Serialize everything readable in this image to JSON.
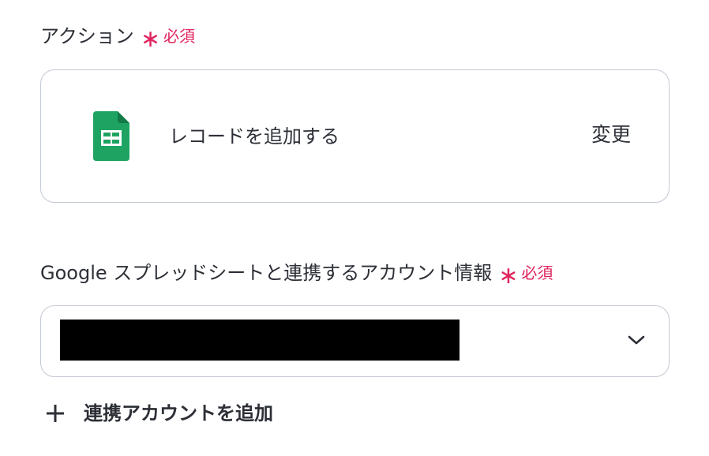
{
  "action_field": {
    "label": "アクション",
    "required_mark": "∗",
    "required_text": "必須",
    "action_name": "レコードを追加する",
    "change_label": "変更",
    "app_icon": "google-sheets-icon"
  },
  "account_field": {
    "label": "Google スプレッドシートと連携するアカウント情報",
    "required_mark": "∗",
    "required_text": "必須",
    "chevron_icon": "chevron-down-icon"
  },
  "add_account": {
    "icon": "plus-icon",
    "label": "連携アカウントを追加"
  },
  "colors": {
    "required": "#e0245e",
    "text": "#2c2f36",
    "border": "#c3c9d2",
    "sheets_green": "#1ea362"
  }
}
